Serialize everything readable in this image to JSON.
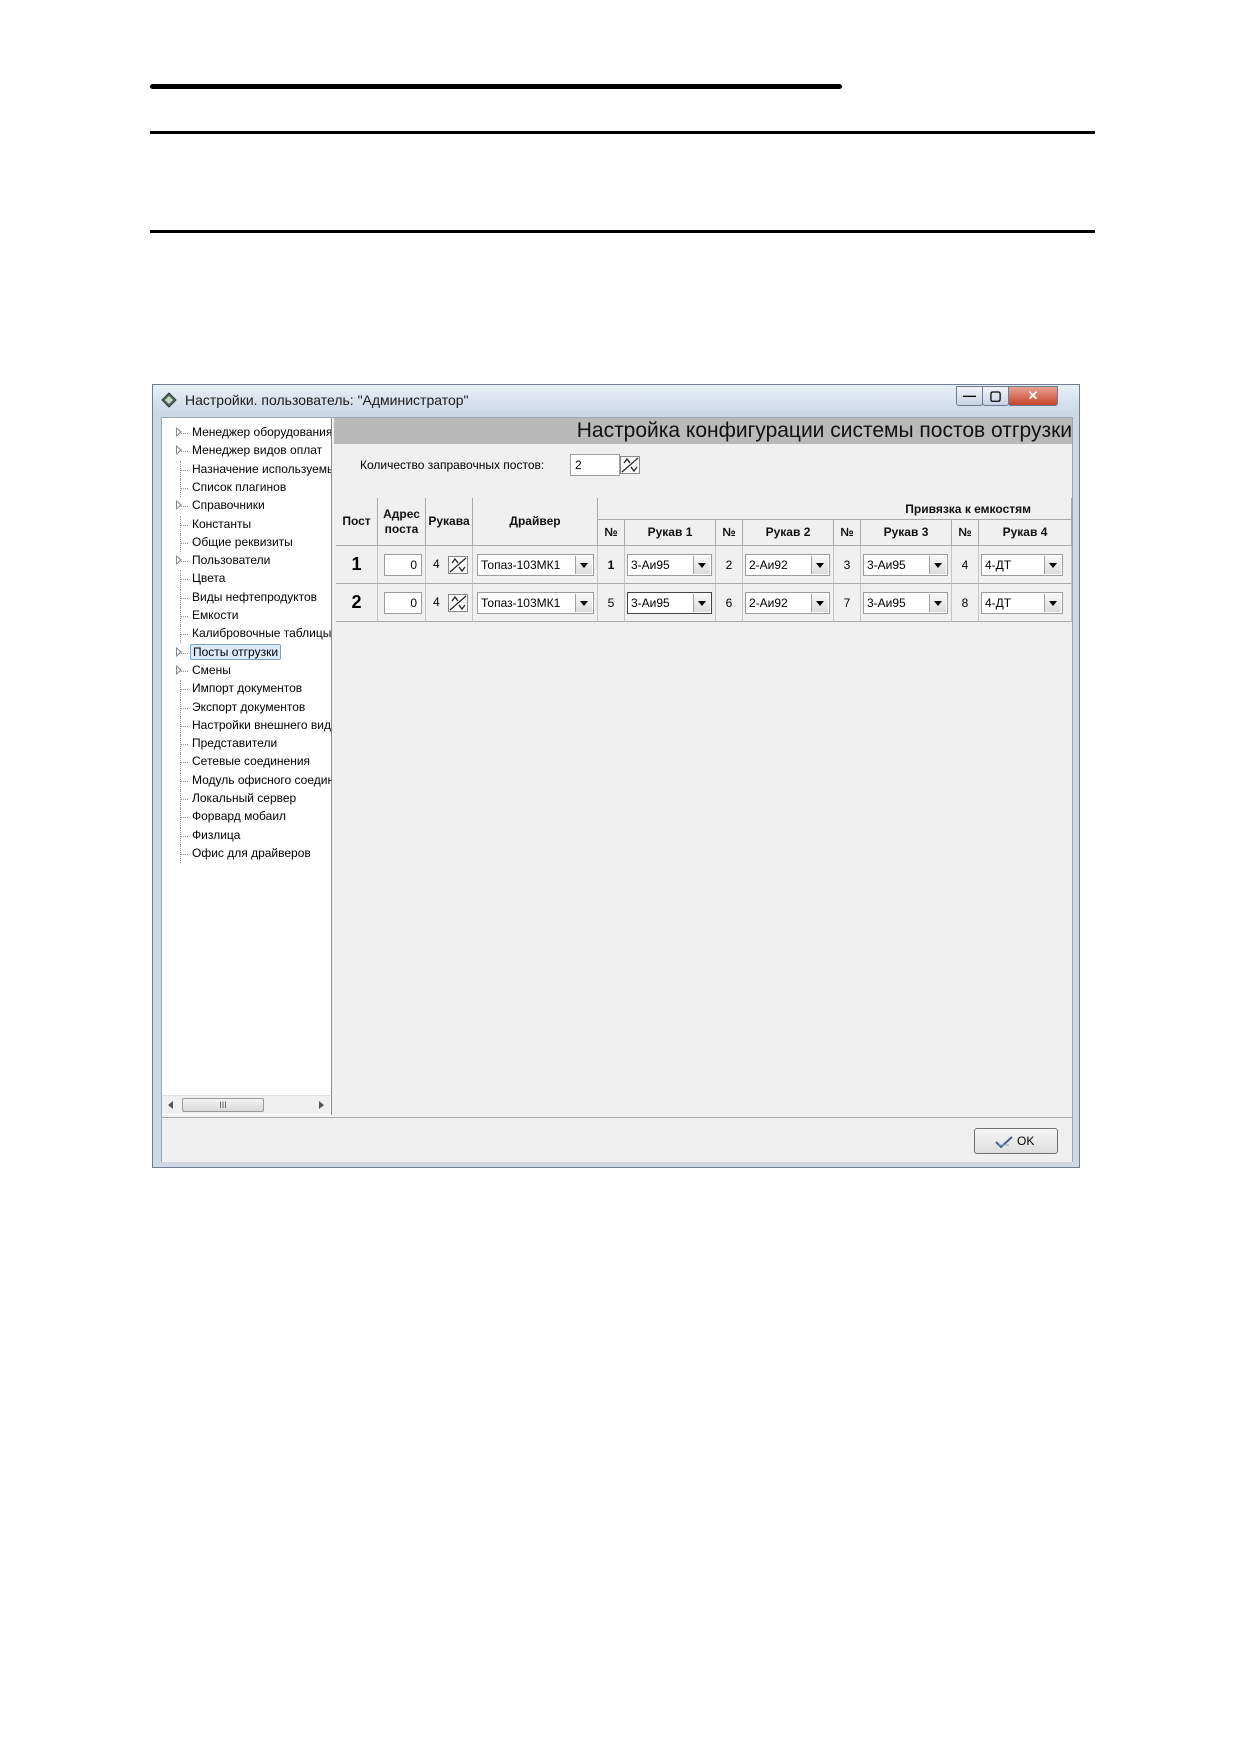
{
  "window": {
    "title": "Настройки. пользователь: \"Администратор\"",
    "min_glyph": "—",
    "max_glyph": "▢",
    "close_glyph": "✕"
  },
  "tree": {
    "items": [
      {
        "label": "Менеджер оборудования",
        "expandable": true
      },
      {
        "label": "Менеджер видов оплат",
        "expandable": true
      },
      {
        "label": "Назначение используемых",
        "expandable": false
      },
      {
        "label": "Список плагинов",
        "expandable": false
      },
      {
        "label": "Справочники",
        "expandable": true
      },
      {
        "label": "Константы",
        "expandable": false
      },
      {
        "label": "Общие реквизиты",
        "expandable": false
      },
      {
        "label": "Пользователи",
        "expandable": true
      },
      {
        "label": "Цвета",
        "expandable": false
      },
      {
        "label": "Виды нефтепродуктов",
        "expandable": false
      },
      {
        "label": "Емкости",
        "expandable": false
      },
      {
        "label": "Калибровочные таблицы",
        "expandable": false
      },
      {
        "label": "Посты отгрузки",
        "expandable": true,
        "selected": true
      },
      {
        "label": "Смены",
        "expandable": true
      },
      {
        "label": "Импорт документов",
        "expandable": false
      },
      {
        "label": "Экспорт документов",
        "expandable": false
      },
      {
        "label": "Настройки внешнего вида",
        "expandable": false
      },
      {
        "label": "Представители",
        "expandable": false
      },
      {
        "label": "Сетевые соединения",
        "expandable": false
      },
      {
        "label": "Модуль офисного соединения",
        "expandable": false
      },
      {
        "label": "Локальный сервер",
        "expandable": false
      },
      {
        "label": "Форвард мобаил",
        "expandable": false
      },
      {
        "label": "Физлица",
        "expandable": false
      },
      {
        "label": "Офис для драйверов",
        "expandable": false
      }
    ],
    "scroll_thumb": "III"
  },
  "main": {
    "title": "Настройка конфигурации системы постов отгрузки",
    "count_label": "Количество заправочных постов:",
    "count_value": "2"
  },
  "table": {
    "headers": {
      "post": "Пост",
      "address": "Адрес поста",
      "hoses": "Рукава",
      "driver": "Драйвер",
      "binding": "Привязка к емкостям",
      "no": "№",
      "hose1": "Рукав 1",
      "hose2": "Рукав 2",
      "hose3": "Рукав 3",
      "hose4": "Рукав 4"
    },
    "rows": [
      {
        "post": "1",
        "address": "0",
        "hoses": "4",
        "driver": "Топаз-103МК1",
        "n1": "1",
        "h1": "3-Аи95",
        "n2": "2",
        "h2": "2-Аи92",
        "n3": "3",
        "h3": "3-Аи95",
        "n4": "4",
        "h4": "4-ДТ"
      },
      {
        "post": "2",
        "address": "0",
        "hoses": "4",
        "driver": "Топаз-103МК1",
        "n1": "5",
        "h1": "3-Аи95",
        "n2": "6",
        "h2": "2-Аи92",
        "n3": "7",
        "h3": "3-Аи95",
        "n4": "8",
        "h4": "4-ДТ"
      }
    ]
  },
  "footer": {
    "ok_label": "OK"
  }
}
